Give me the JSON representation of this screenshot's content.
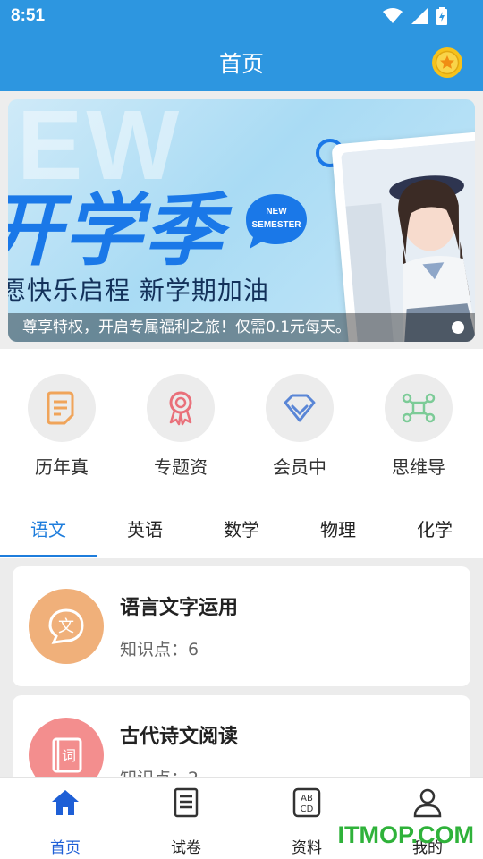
{
  "status_bar": {
    "time": "8:51"
  },
  "header": {
    "title": "首页"
  },
  "banner": {
    "watermark_text": "EW",
    "main_text": "开学季",
    "bubble_text": "NEW\nSEMESTER",
    "slogan": "愿快乐启程  新学期加油",
    "caption": "尊享特权，开启专属福利之旅！仅需0.1元每天。"
  },
  "quick_links": [
    {
      "label": "历年真",
      "icon": "document-icon"
    },
    {
      "label": "专题资",
      "icon": "award-icon"
    },
    {
      "label": "会员中",
      "icon": "diamond-icon"
    },
    {
      "label": "思维导",
      "icon": "mindmap-icon"
    }
  ],
  "tabs": [
    "语文",
    "英语",
    "数学",
    "物理",
    "化学"
  ],
  "active_tab": "语文",
  "cards": [
    {
      "title": "语言文字运用",
      "subtitle": "知识点：6",
      "icon_glyph": "文",
      "color": "#f0b07a"
    },
    {
      "title": "古代诗文阅读",
      "subtitle": "知识点：2",
      "icon_glyph": "词",
      "color": "#f38e8e"
    }
  ],
  "bottom_nav": [
    {
      "label": "首页",
      "icon": "home-icon"
    },
    {
      "label": "试卷",
      "icon": "paper-icon"
    },
    {
      "label": "资料",
      "icon": "abcd-icon"
    },
    {
      "label": "我的",
      "icon": "person-icon"
    }
  ],
  "watermark": "ITMOP.COM",
  "colors": {
    "primary": "#2d96e0",
    "accent": "#1e7ddc",
    "nav_active": "#1e5fd6"
  }
}
